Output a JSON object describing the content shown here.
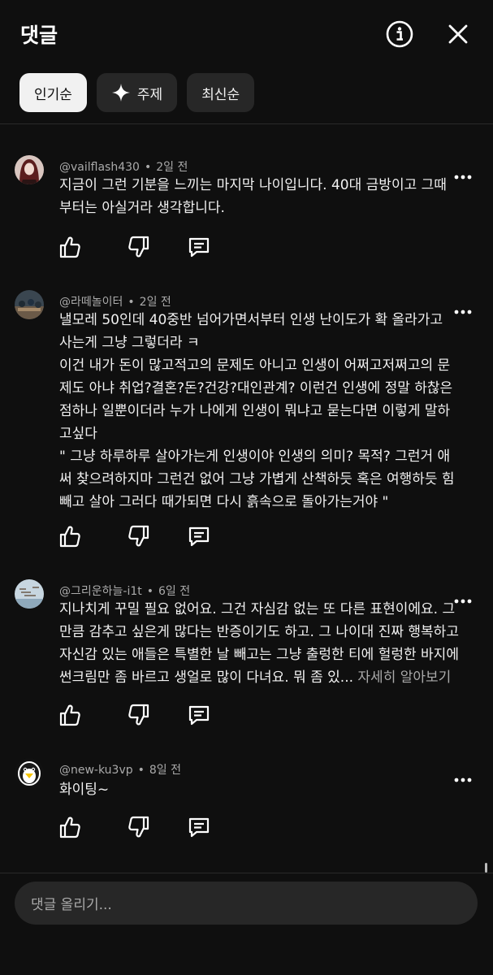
{
  "header": {
    "title": "댓글",
    "info_icon": "info-icon",
    "close_icon": "close-icon"
  },
  "tabs": [
    {
      "label": "인기순",
      "active": true
    },
    {
      "label": "주제",
      "icon": "sparkle-icon",
      "active": false
    },
    {
      "label": "최신순",
      "active": false
    }
  ],
  "comments": [
    {
      "author": "@vailflash430",
      "time": "2일 전",
      "text": "지금이 그런 기분을 느끼는 마지막 나이입니다. 40대 금방이고 그때\n부터는 아실거라 생각합니다."
    },
    {
      "author": "@라떼놀이터",
      "time": "2일 전",
      "text": "낼모레 50인데 40중반 넘어가면서부터 인생 난이도가 확 올라가고\n사는게 그냥 그렇더라 ㅋ\n이건 내가 돈이 많고적고의 문제도 아니고 인생이 어쩌고저쩌고의 문\n제도 아냐 취업?결혼?돈?건강?대인관계? 이런건 인생에 정말 하찮은\n점하나 일뿐이더라 누가 나에게 인생이 뭐냐고 묻는다면 이렇게 말하\n고싶다\n\" 그냥 하루하루 살아가는게 인생이야 인생의 의미? 목적? 그런거 애\n써 찾으려하지마 그런건 없어 그냥 가볍게 산책하듯 혹은 여행하듯 힘\n빼고 살아 그러다 때가되면 다시 흙속으로 돌아가는거야 \""
    },
    {
      "author": "@그리운하늘-i1t",
      "time": "6일 전",
      "text": "지나치게 꾸밀 필요 없어요. 그건 자심감 없는 또 다른 표현이에요. 그\n만큼 감추고 싶은게 많다는 반증이기도 하고. 그 나이대 진짜 행복하고\n자신감 있는 애들은 특별한 날 빼고는 그냥 출렁한 티에 헐렁한 바지에\n썬크림만 좀 바르고 생얼로 많이 다녀요. 뭐 좀 있... ",
      "more_label": "자세히 알아보기"
    },
    {
      "author": "@new-ku3vp",
      "time": "8일 전",
      "text": "화이팅~"
    }
  ],
  "comment_actions": {
    "like_icon": "thumbs-up-icon",
    "dislike_icon": "thumbs-down-icon",
    "reply_icon": "reply-icon",
    "menu_icon": "more-vertical-icon"
  },
  "input": {
    "placeholder": "댓글 올리기..."
  }
}
